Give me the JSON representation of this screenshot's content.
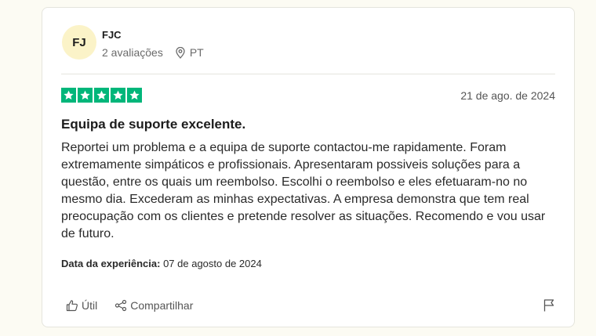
{
  "review": {
    "avatar_initials": "FJ",
    "reviewer_name": "FJC",
    "review_count": "2 avaliações",
    "country": "PT",
    "rating": 5,
    "rating_max": 5,
    "date": "21 de ago. de 2024",
    "title": "Equipa de suporte excelente.",
    "body": "Reportei um problema e a equipa de suporte contactou-me rapidamente. Foram extremamente simpáticos e profissionais. Apresentaram possiveis soluções para a questão, entre os quais um reembolso. Escolhi o reembolso e eles efetuaram-no no mesmo dia. Excederam as minhas expectativas. A empresa demonstra que tem real preocupação com os clientes e pretende resolver as situações. Recomendo e vou usar de futuro.",
    "experience_label": "Data da experiência:",
    "experience_date": "07 de agosto de 2024"
  },
  "actions": {
    "useful_label": "Útil",
    "share_label": "Compartilhar"
  },
  "colors": {
    "star_green": "#00b67a",
    "avatar_bg": "#fbf3c8",
    "page_bg": "#fcfbf3"
  },
  "icons": [
    "location-pin-icon",
    "star-icon",
    "thumbs-up-icon",
    "share-icon",
    "flag-icon"
  ]
}
